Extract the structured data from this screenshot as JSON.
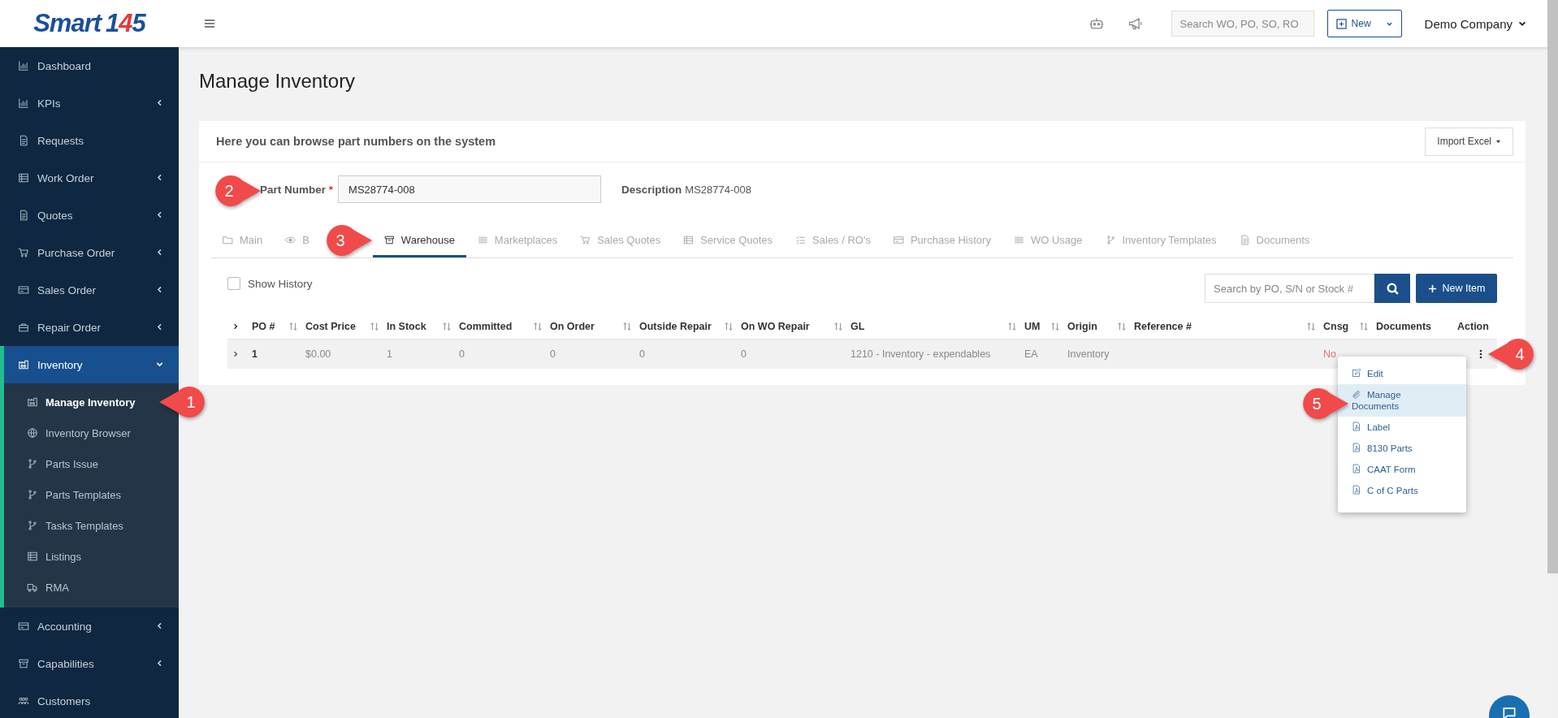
{
  "logo": {
    "word": "Smart",
    "number": "145"
  },
  "sidebar": {
    "items": [
      {
        "label": "Dashboard",
        "selected": false
      },
      {
        "label": "KPIs",
        "selected": false,
        "expanded": false
      },
      {
        "label": "Requests",
        "selected": false
      },
      {
        "label": "Work Order",
        "selected": false,
        "expanded": false
      },
      {
        "label": "Quotes",
        "selected": false,
        "expanded": false
      },
      {
        "label": "Purchase Order",
        "selected": false,
        "expanded": false
      },
      {
        "label": "Sales Order",
        "selected": false,
        "expanded": false
      },
      {
        "label": "Repair Order",
        "selected": false,
        "expanded": false
      },
      {
        "label": "Inventory",
        "selected": true,
        "expanded": true,
        "children": [
          {
            "label": "Manage Inventory",
            "selected": true,
            "callout": "1"
          },
          {
            "label": "Inventory Browser",
            "selected": false
          },
          {
            "label": "Parts Issue",
            "selected": false
          },
          {
            "label": "Parts Templates",
            "selected": false
          },
          {
            "label": "Tasks Templates",
            "selected": false
          },
          {
            "label": "Listings",
            "selected": false
          },
          {
            "label": "RMA",
            "selected": false
          }
        ]
      },
      {
        "label": "Accounting",
        "selected": false,
        "expanded": false
      },
      {
        "label": "Capabilities",
        "selected": false,
        "expanded": false
      },
      {
        "label": "Customers",
        "selected": false
      }
    ]
  },
  "topbar": {
    "search": {
      "placeholder": "Search WO, PO, SO, RO"
    },
    "new_button": "New",
    "company": "Demo Company"
  },
  "page_title": "Manage Inventory",
  "card": {
    "intro": "Here you can browse part numbers on the system",
    "import_button": "Import Excel",
    "part_number": {
      "label": "Part Number",
      "required": "*",
      "value": "MS28774-008",
      "callout": "2"
    },
    "description": {
      "label": "Description",
      "value": "MS28774-008"
    },
    "tabs": [
      {
        "label": "Main",
        "selected": false
      },
      {
        "label": "B",
        "selected": false
      },
      {
        "label": "Warehouse",
        "selected": true,
        "callout": "3"
      },
      {
        "label": "Marketplaces",
        "selected": false
      },
      {
        "label": "Sales Quotes",
        "selected": false
      },
      {
        "label": "Service Quotes",
        "selected": false
      },
      {
        "label": "Sales / RO's",
        "selected": false
      },
      {
        "label": "Purchase History",
        "selected": false
      },
      {
        "label": "WO Usage",
        "selected": false
      },
      {
        "label": "Inventory Templates",
        "selected": false
      },
      {
        "label": "Documents",
        "selected": false
      }
    ],
    "show_history": {
      "label": "Show History",
      "checked": false
    },
    "search": {
      "placeholder": "Search by PO, S/N or Stock #"
    },
    "new_item_button": "New Item",
    "table": {
      "columns": [
        {
          "kind": "expand"
        },
        {
          "label": "PO #",
          "kind": "bold",
          "sortable": true
        },
        {
          "label": "Cost Price",
          "kind": "text",
          "sortable": true
        },
        {
          "label": "In Stock",
          "kind": "text",
          "sortable": true
        },
        {
          "label": "Committed",
          "kind": "text",
          "sortable": true
        },
        {
          "label": "On Order",
          "kind": "text",
          "sortable": true
        },
        {
          "label": "Outside Repair",
          "kind": "text",
          "sortable": true
        },
        {
          "label": "On WO Repair",
          "kind": "text",
          "sortable": true
        },
        {
          "label": "GL",
          "kind": "text",
          "sortable": true
        },
        {
          "label": "UM",
          "kind": "text",
          "sortable": true
        },
        {
          "label": "Origin",
          "kind": "text",
          "sortable": true
        },
        {
          "label": "Reference #",
          "kind": "text",
          "sortable": true
        },
        {
          "label": "Cnsg",
          "kind": "flag",
          "sortable": true
        },
        {
          "label": "Documents",
          "kind": "text",
          "sortable": false
        },
        {
          "label": "Action",
          "kind": "action",
          "sortable": false
        }
      ],
      "rows": [
        {
          "expanded": false,
          "cells": [
            "",
            "1",
            "$0.00",
            "1",
            "0",
            "0",
            "0",
            "0",
            "1210 - Inventory - expendables",
            "EA",
            "Inventory",
            "",
            "No",
            "",
            ""
          ],
          "callout": "4",
          "menu": [
            {
              "label": "Edit",
              "selected": false
            },
            {
              "label": "Manage Documents",
              "selected": true,
              "callout": "5"
            },
            {
              "label": "Label",
              "selected": false
            },
            {
              "label": "8130 Parts",
              "selected": false
            },
            {
              "label": "CAAT Form",
              "selected": false
            },
            {
              "label": "C of C Parts",
              "selected": false
            }
          ]
        }
      ]
    }
  }
}
